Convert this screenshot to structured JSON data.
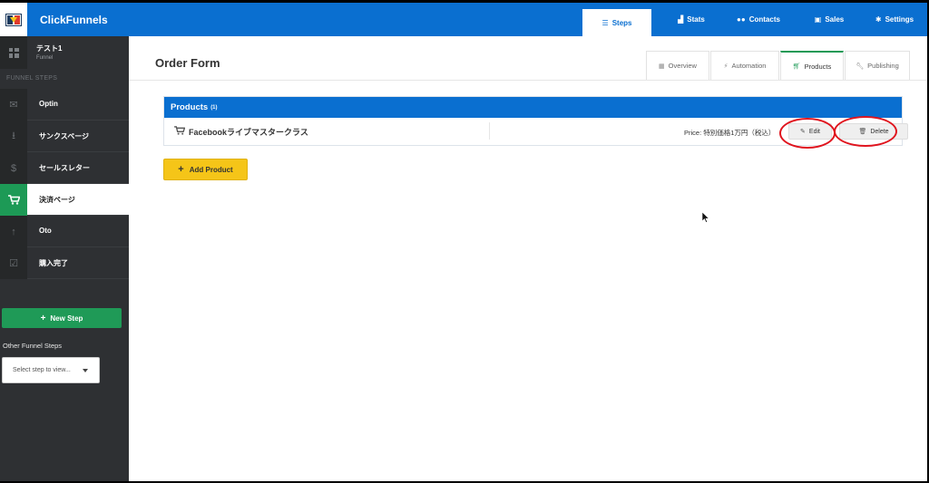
{
  "app": {
    "brand": "ClickFunnels",
    "colors": {
      "primary": "#0a6fd0",
      "success": "#1d9a56",
      "warning": "#f5c518",
      "sidebar": "#2e3033",
      "annotation": "#e0141e"
    }
  },
  "topnav": {
    "steps": "Steps",
    "stats": "Stats",
    "contacts": "Contacts",
    "sales": "Sales",
    "settings": "Settings"
  },
  "sidebar": {
    "funnel_name": "テスト1",
    "funnel_type": "Funnel",
    "section_label": "FUNNEL STEPS",
    "items": [
      {
        "label": "Optin",
        "icon": "envelope-icon",
        "active": false
      },
      {
        "label": "サンクスページ",
        "icon": "download-icon",
        "active": false
      },
      {
        "label": "セールスレター",
        "icon": "dollar-icon",
        "active": false
      },
      {
        "label": "決済ページ",
        "icon": "cart-icon",
        "active": true
      },
      {
        "label": "Oto",
        "icon": "arrow-up-icon",
        "active": false
      },
      {
        "label": "購入完了",
        "icon": "check-square-icon",
        "active": false
      }
    ],
    "new_step": "New Step",
    "other_label": "Other Funnel Steps",
    "select_placeholder": "Select step to view..."
  },
  "main": {
    "title": "Order Form",
    "tabs": {
      "overview": "Overview",
      "automation": "Automation",
      "products": "Products",
      "publishing": "Publishing"
    },
    "panel": {
      "title": "Products",
      "count": "(1)",
      "product_name": "Facebookライブマスタークラス",
      "price": "Price: 特別価格1万円（税込）",
      "edit": "Edit",
      "delete": "Delete"
    },
    "add_product": "Add Product"
  }
}
